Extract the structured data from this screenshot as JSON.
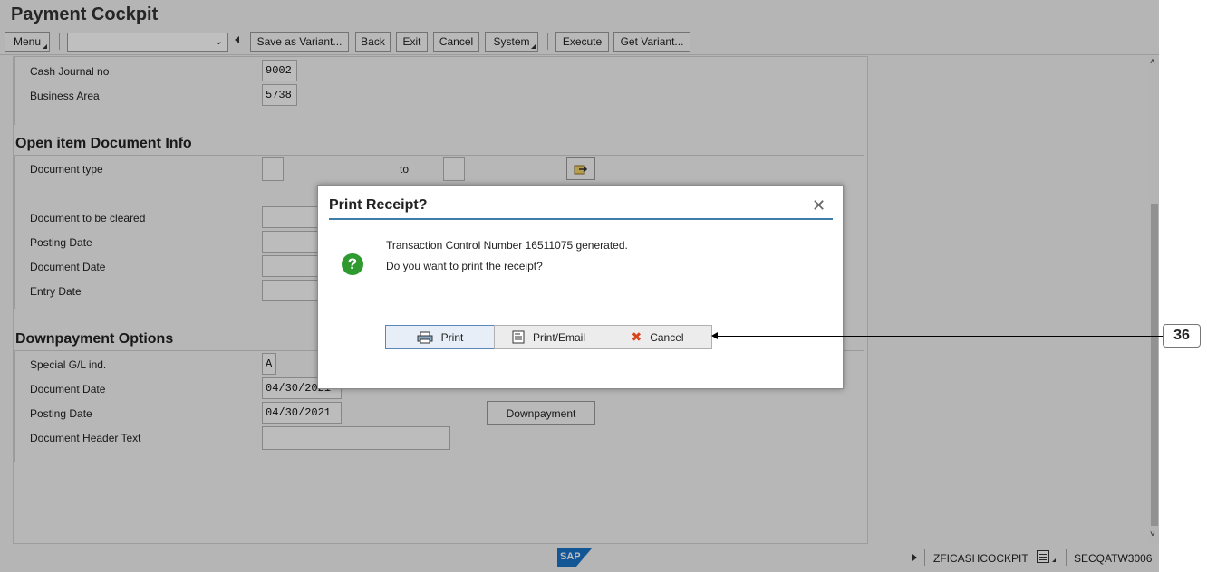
{
  "app": {
    "title": "Payment Cockpit"
  },
  "toolbar": {
    "menu": "Menu",
    "save_variant": "Save as Variant...",
    "back": "Back",
    "exit": "Exit",
    "cancel": "Cancel",
    "system": "System",
    "execute": "Execute",
    "get_variant": "Get Variant...",
    "combo_value": ""
  },
  "form": {
    "cash_journal_label": "Cash Journal  no",
    "cash_journal_value": "9002",
    "business_area_label": "Business Area",
    "business_area_value": "5738",
    "section_open_item": "Open item Document Info",
    "doc_type_label": "Document type",
    "to_label": "to",
    "doc_cleared_label": "Document to be cleared",
    "posting_date_label": "Posting Date",
    "document_date_label": "Document Date",
    "entry_date_label": "Entry Date",
    "section_downpayment": "Downpayment Options",
    "special_gl_label": "Special G/L ind.",
    "special_gl_value": "A",
    "dp_document_date_label": "Document Date",
    "dp_document_date_value": "04/30/2021",
    "dp_posting_date_label": "Posting Date",
    "dp_posting_date_value": "04/30/2021",
    "doc_header_text_label": "Document Header Text",
    "downpayment_button": "Downpayment"
  },
  "dialog": {
    "title": "Print Receipt?",
    "line1": "Transaction Control Number 16511075 generated.",
    "line2": "Do you want to print the receipt?",
    "print": "Print",
    "print_email": "Print/Email",
    "cancel": "Cancel"
  },
  "annotation": {
    "step": "36"
  },
  "statusbar": {
    "logo": "SAP",
    "transaction": "ZFICASHCOCKPIT",
    "system": "SECQATW3006"
  }
}
